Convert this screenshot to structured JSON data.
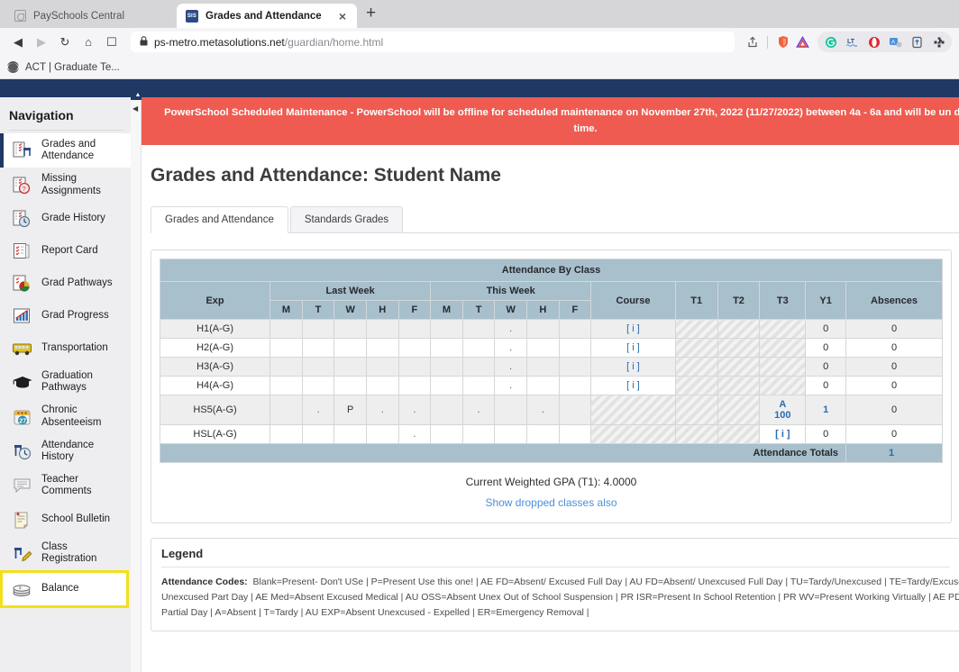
{
  "browser": {
    "tabs": [
      {
        "title": "PaySchools Central",
        "icon": "page-icon",
        "active": false
      },
      {
        "title": "Grades and Attendance",
        "icon": "sis-favicon",
        "favicon_text": "SIS",
        "active": true
      }
    ],
    "tab_close_label": "×",
    "new_tab_label": "+",
    "nav": {
      "back": "◀",
      "forward": "▶",
      "reload": "↻",
      "home": "⌂",
      "bookmark": "☐"
    },
    "url": {
      "lock": "🔒",
      "host": "ps-metro.metasolutions.net",
      "path": "/guardian/home.html"
    },
    "toolbar_icons": [
      "share-icon",
      "brave-shield-icon",
      "triangle-icon",
      "grammarly-icon",
      "lt-icon",
      "opera-icon",
      "translate-icon",
      "upload-icon",
      "puzzle-icon"
    ],
    "bookmarks": [
      {
        "label": "ACT | Graduate Te...",
        "icon": "globe-icon"
      }
    ]
  },
  "sidebar": {
    "title": "Navigation",
    "items": [
      {
        "label": "Grades and\nAttendance",
        "icon": "grades-attendance-icon",
        "state": "active"
      },
      {
        "label": "Missing\nAssignments",
        "icon": "missing-assignments-icon",
        "state": "normal"
      },
      {
        "label": "Grade History",
        "icon": "grade-history-icon",
        "state": "normal"
      },
      {
        "label": "Report Card",
        "icon": "report-card-icon",
        "state": "normal"
      },
      {
        "label": "Grad Pathways",
        "icon": "grad-pathways-icon",
        "state": "normal"
      },
      {
        "label": "Grad Progress",
        "icon": "grad-progress-icon",
        "state": "normal"
      },
      {
        "label": "Transportation",
        "icon": "bus-icon",
        "state": "normal"
      },
      {
        "label": "Graduation\nPathways",
        "icon": "graduation-cap-icon",
        "state": "normal"
      },
      {
        "label": "Chronic\nAbsenteeism",
        "icon": "calendar-icon",
        "state": "normal"
      },
      {
        "label": "Attendance\nHistory",
        "icon": "attendance-history-icon",
        "state": "normal"
      },
      {
        "label": "Teacher\nComments",
        "icon": "comments-icon",
        "state": "normal"
      },
      {
        "label": "School Bulletin",
        "icon": "bulletin-icon",
        "state": "normal"
      },
      {
        "label": "Class\nRegistration",
        "icon": "class-registration-icon",
        "state": "normal"
      },
      {
        "label": "Balance",
        "icon": "coins-icon",
        "state": "highlight"
      }
    ]
  },
  "alert": {
    "text": "PowerSchool Scheduled Maintenance - PowerSchool will be offline for scheduled maintenance on November 27th, 2022 (11/27/2022) between 4a - 6a and will be un during this time."
  },
  "main": {
    "page_title": "Grades and Attendance: Student Name",
    "tabs": [
      {
        "label": "Grades and Attendance",
        "active": true
      },
      {
        "label": "Standards Grades",
        "active": false
      }
    ],
    "gpa_text": "Current Weighted GPA (T1): 4.0000",
    "show_dropped_link": "Show dropped classes also"
  },
  "table": {
    "banner": "Attendance By Class",
    "group_headers": {
      "exp": "Exp",
      "last_week": "Last Week",
      "this_week": "This Week",
      "course": "Course",
      "t1": "T1",
      "t2": "T2",
      "t3": "T3",
      "y1": "Y1",
      "absences": "Absences"
    },
    "day_headers": [
      "M",
      "T",
      "W",
      "H",
      "F"
    ],
    "info_link": "[ i ]",
    "rows": [
      {
        "exp": "H1(A-G)",
        "last_week": [
          "",
          "",
          "",
          "",
          ""
        ],
        "this_week": [
          "",
          "",
          ".",
          "",
          ""
        ],
        "course": "[ i ]",
        "course_hatched": false,
        "t1": "",
        "t2": "",
        "t3": "",
        "terms_hatched": true,
        "t3_hatched": true,
        "y1": "0",
        "absences": "0"
      },
      {
        "exp": "H2(A-G)",
        "last_week": [
          "",
          "",
          "",
          "",
          ""
        ],
        "this_week": [
          "",
          "",
          ".",
          "",
          ""
        ],
        "course": "[ i ]",
        "course_hatched": false,
        "t1": "",
        "t2": "",
        "t3": "",
        "terms_hatched": true,
        "t3_hatched": true,
        "y1": "0",
        "absences": "0"
      },
      {
        "exp": "H3(A-G)",
        "last_week": [
          "",
          "",
          "",
          "",
          ""
        ],
        "this_week": [
          "",
          "",
          ".",
          "",
          ""
        ],
        "course": "[ i ]",
        "course_hatched": false,
        "t1": "",
        "t2": "",
        "t3": "",
        "terms_hatched": true,
        "t3_hatched": true,
        "y1": "0",
        "absences": "0"
      },
      {
        "exp": "H4(A-G)",
        "last_week": [
          "",
          "",
          "",
          "",
          ""
        ],
        "this_week": [
          "",
          "",
          ".",
          "",
          ""
        ],
        "course": "[ i ]",
        "course_hatched": false,
        "t1": "",
        "t2": "",
        "t3": "",
        "terms_hatched": true,
        "t3_hatched": true,
        "y1": "0",
        "absences": "0"
      },
      {
        "exp": "HS5(A-G)",
        "last_week": [
          "",
          ".",
          "P",
          ".",
          "."
        ],
        "this_week": [
          "",
          ".",
          "",
          ".",
          ""
        ],
        "course": "",
        "course_hatched": true,
        "t1": "",
        "t2": "",
        "t3": "A\n100",
        "terms_hatched": true,
        "t3_hatched": false,
        "t3_link": true,
        "y1": "1",
        "y1_link": true,
        "absences": "0"
      },
      {
        "exp": "HSL(A-G)",
        "last_week": [
          "",
          "",
          "",
          "",
          "."
        ],
        "this_week": [
          "",
          "",
          "",
          "",
          ""
        ],
        "course": "",
        "course_hatched": true,
        "t1": "",
        "t2": "",
        "t3": "[ i ]",
        "terms_hatched": true,
        "t3_hatched": false,
        "t3_link": true,
        "y1": "0",
        "absences": "0"
      }
    ],
    "totals_label": "Attendance Totals",
    "totals_value": "1"
  },
  "legend": {
    "heading": "Legend",
    "codes_label": "Attendance Codes:",
    "codes_text": "Blank=Present- Don't USe | P=Present Use this one! | AE FD=Absent/ Excused Full Day | AU FD=Absent/ Unexcused Full Day | TU=Tardy/Unexcused | TE=Tardy/Excused Unexcused Part Day | AE Med=Absent Excused Medical | AU OSS=Absent Unex Out of School Suspension | PR ISR=Present In School Retention | PR WV=Present Working Virtually | AE PD=A Partial Day | A=Absent | T=Tardy | AU EXP=Absent Unexcused - Expelled | ER=Emergency Removal |",
    "line1": "Blank=Present- Don't USe | P=Present Use this one! | AE FD=Absent/ Excused Full Day | AU FD=Absent/ Unexcused Full Day | TU=Tardy/Unexcused | TE=Tardy/Excused",
    "line2": "Unexcused Part Day | AE Med=Absent Excused Medical | AU OSS=Absent Unex Out of School Suspension | PR ISR=Present In School Retention | PR WV=Present Working Virtually | AE PD=A",
    "line3": "Partial Day | A=Absent | T=Tardy | AU EXP=Absent Unexcused - Expelled | ER=Emergency Removal |"
  },
  "colors": {
    "topbar": "#1f3864",
    "alert": "#ef5b50",
    "table_header": "#a8bfcc",
    "link": "#2b6cb0",
    "highlight": "#f3e019"
  }
}
